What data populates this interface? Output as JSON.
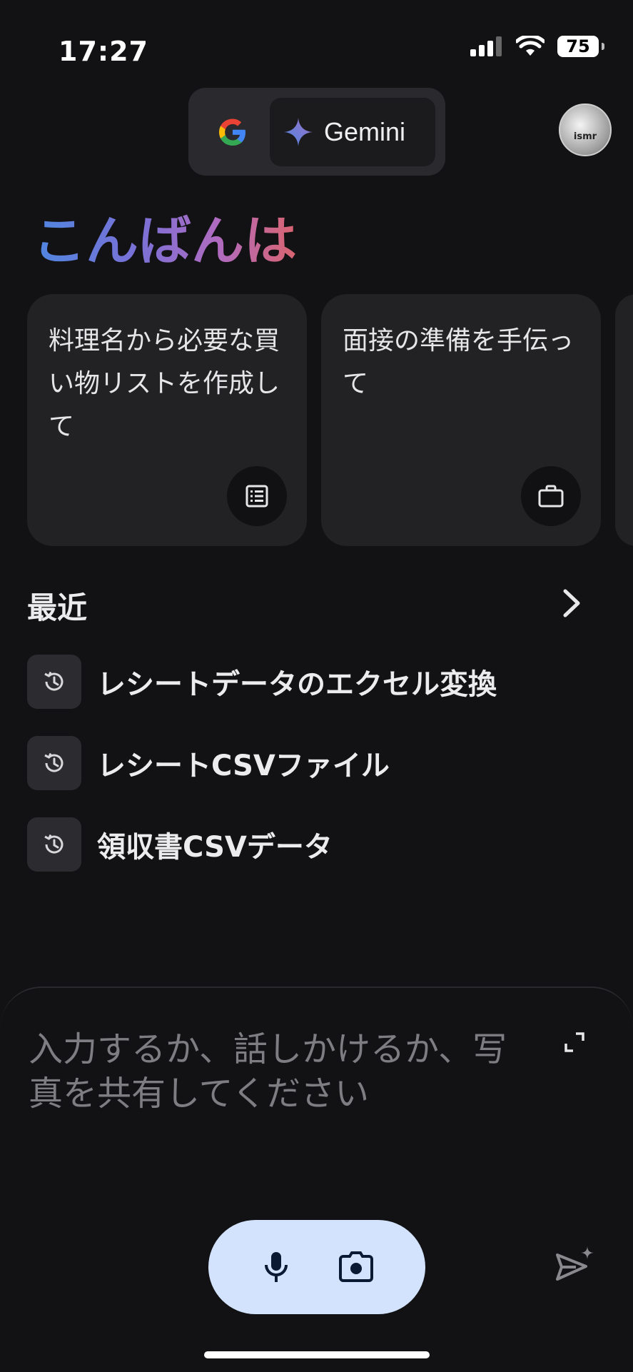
{
  "status": {
    "time": "17:27",
    "battery": "75"
  },
  "switcher": {
    "google_label": "G",
    "gemini_label": "Gemini"
  },
  "profile": {
    "avatar_text": "ismr"
  },
  "greeting": "こんばんは",
  "cards": [
    {
      "text": "料理名から必要な買い物リストを作成して",
      "icon": "list-icon"
    },
    {
      "text": "面接の準備を手伝って",
      "icon": "briefcase-icon"
    }
  ],
  "recent": {
    "title": "最近",
    "items": [
      {
        "label": "レシートデータのエクセル変換"
      },
      {
        "label": "レシートCSVファイル"
      },
      {
        "label": "領収書CSVデータ"
      }
    ]
  },
  "input": {
    "placeholder": "入力するか、話しかけるか、写真を共有してください"
  },
  "colors": {
    "pill": "#d3e3fd",
    "background": "#121214",
    "card": "#222225"
  }
}
